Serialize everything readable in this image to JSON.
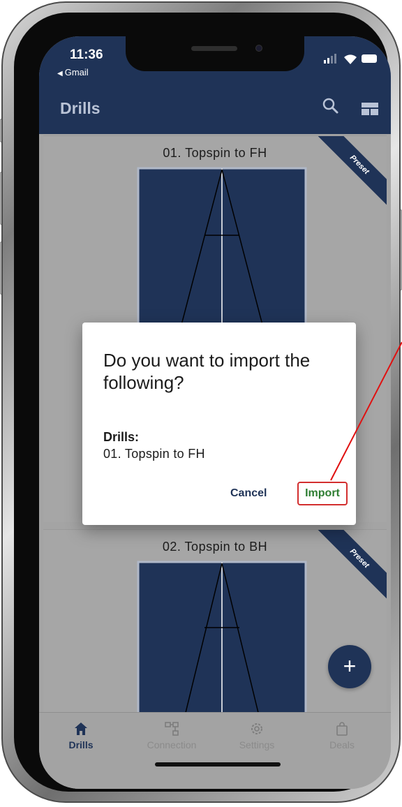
{
  "status_bar": {
    "time": "11:36",
    "back_app": "Gmail"
  },
  "app_bar": {
    "title": "Drills",
    "search_icon": "search-icon",
    "layout_icon": "view-module-icon"
  },
  "drills": [
    {
      "title": "01. Topspin to FH",
      "badge": "Preset"
    },
    {
      "title": "02. Topspin to BH",
      "badge": "Preset"
    }
  ],
  "dialog": {
    "title": "Do you want to import the following?",
    "subtitle": "Drills:",
    "item": "01. Topspin to FH",
    "cancel_label": "Cancel",
    "import_label": "Import"
  },
  "fab": {
    "label": "+"
  },
  "bottom_nav": {
    "items": [
      {
        "label": "Drills",
        "icon": "home-icon",
        "active": true
      },
      {
        "label": "Connection",
        "icon": "network-icon",
        "active": false
      },
      {
        "label": "Settings",
        "icon": "gear-icon",
        "active": false
      },
      {
        "label": "Deals",
        "icon": "shopping-bag-icon",
        "active": false
      }
    ]
  },
  "colors": {
    "brand_navy": "#1f3357",
    "overlay_grey": "#a4a4a4",
    "import_green": "#2e7d32",
    "highlight_red": "#d32f2f"
  }
}
